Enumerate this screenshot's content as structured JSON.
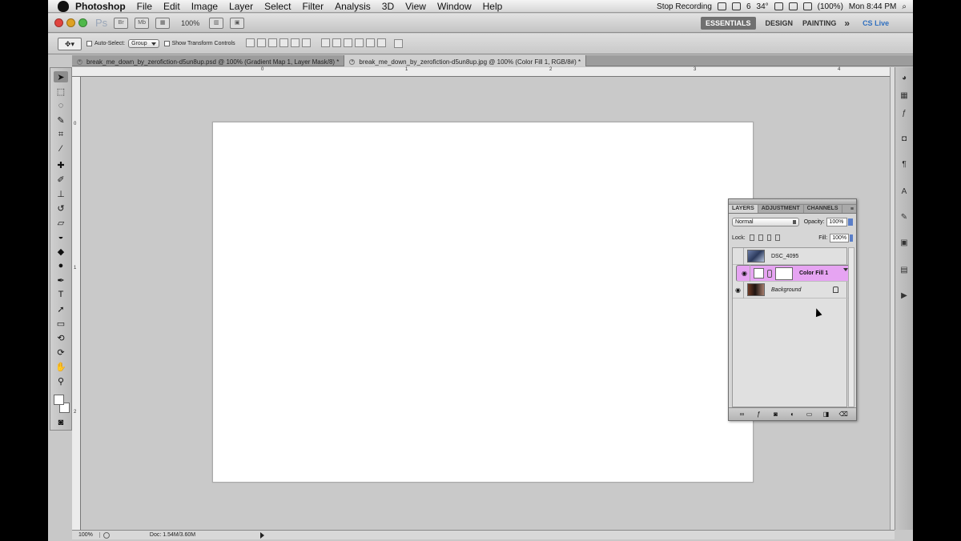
{
  "menubar": {
    "app": "Photoshop",
    "items": [
      "File",
      "Edit",
      "Image",
      "Layer",
      "Select",
      "Filter",
      "Analysis",
      "3D",
      "View",
      "Window",
      "Help"
    ],
    "right": {
      "recording": "Stop Recording",
      "adobe_count": "6",
      "temp": "34°",
      "battery": "(100%)",
      "clock": "Mon 8:44 PM"
    }
  },
  "appbar": {
    "logo": "Ps",
    "bridge": "Br",
    "minibridge": "Mb",
    "zoom": "100%",
    "workspaces": [
      "ESSENTIALS",
      "DESIGN",
      "PAINTING"
    ],
    "more": "»",
    "cslive": "CS Live"
  },
  "options": {
    "auto_select": "Auto-Select:",
    "group": "Group",
    "show_transform": "Show Transform Controls"
  },
  "tabs": [
    {
      "label": "break_me_down_by_zerofiction-d5un8up.psd @ 100% (Gradient Map 1, Layer Mask/8) *"
    },
    {
      "label": "break_me_down_by_zerofiction-d5un8up.jpg @ 100% (Color Fill 1, RGB/8#) *"
    }
  ],
  "rulers": {
    "top": [
      "0",
      "1",
      "2",
      "3",
      "4"
    ],
    "left": [
      "0",
      "1",
      "2"
    ]
  },
  "status": {
    "zoom": "100%",
    "doc": "Doc: 1.54M/3.60M"
  },
  "layers_panel": {
    "tabs": [
      "LAYERS",
      "ADJUSTMENT",
      "CHANNELS"
    ],
    "blend_mode": "Normal",
    "opacity_label": "Opacity:",
    "opacity_value": "100%",
    "lock_label": "Lock:",
    "fill_label": "Fill:",
    "fill_value": "100%",
    "layers": [
      {
        "name": "DSC_4095",
        "visible": false,
        "selected": false
      },
      {
        "name": "Color Fill 1",
        "visible": true,
        "selected": true
      },
      {
        "name": "Background",
        "visible": true,
        "selected": false,
        "locked": true
      }
    ]
  },
  "colors": {
    "selected_layer": "#e6a4f2",
    "workspace_bg": "#c8c8c8",
    "canvas": "#ffffff"
  }
}
